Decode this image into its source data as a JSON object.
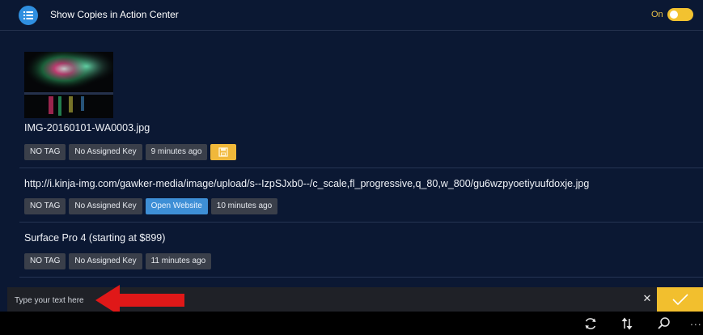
{
  "header": {
    "icon": "list-icon",
    "title": "Show Copies in Action Center",
    "toggle_label": "On",
    "toggle_on": true,
    "accent_color": "#f2c230"
  },
  "items": [
    {
      "type": "image",
      "thumbnail": "fireworks-image",
      "title": "IMG-20160101-WA0003.jpg",
      "tag": "NO TAG",
      "key": "No Assigned Key",
      "time": "9 minutes ago",
      "action_icon": "save-icon"
    },
    {
      "type": "link",
      "title": "http://i.kinja-img.com/gawker-media/image/upload/s--IzpSJxb0--/c_scale,fl_progressive,q_80,w_800/gu6wzpyoetiyuufdoxje.jpg",
      "tag": "NO TAG",
      "key": "No Assigned Key",
      "action": "Open Website",
      "time": "10 minutes ago"
    },
    {
      "type": "text",
      "title": "Surface Pro 4 (starting at $899)",
      "tag": "NO TAG",
      "key": "No Assigned Key",
      "time": "11 minutes ago"
    }
  ],
  "input": {
    "placeholder": "Type your text here",
    "clear_icon": "close-icon",
    "confirm_icon": "checkmark-icon"
  },
  "bottom_bar": {
    "icons": [
      "sync-icon",
      "sort-icon",
      "search-icon",
      "more-icon"
    ],
    "more_label": "..."
  }
}
